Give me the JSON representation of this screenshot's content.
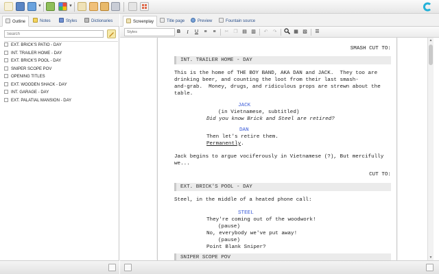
{
  "toolbar": {
    "icons": [
      "new-document-icon",
      "open-folder-icon",
      "save-disk-icon",
      "refresh-sync-icon",
      "google-drive-icon",
      "cut-icon",
      "upload-icon",
      "print-icon",
      "share-icon",
      "export-icon",
      "grid-icon"
    ],
    "logo": "celtx-logo"
  },
  "left_panel": {
    "tabs": [
      {
        "label": "Outline",
        "icon": "outline-icon",
        "active": true
      },
      {
        "label": "Notes",
        "icon": "notes-icon",
        "active": false
      },
      {
        "label": "Styles",
        "icon": "styles-icon",
        "active": false
      },
      {
        "label": "Dictionaries",
        "icon": "book-icon",
        "active": false
      }
    ],
    "search_placeholder": "Search",
    "outline_items": [
      "EXT. BRICK'S PATIO - DAY",
      "INT. TRAILER HOME - DAY",
      "EXT. BRICK'S POOL - DAY",
      "SNIPER SCOPE POV",
      "OPENING TITLES",
      "EXT. WOODEN SHACK - DAY",
      "INT. GARAGE - DAY",
      "EXT. PALATIAL MANSION - DAY"
    ]
  },
  "right_panel": {
    "tabs": [
      {
        "label": "Screenplay",
        "icon": "screenplay-icon",
        "active": true
      },
      {
        "label": "Title page",
        "icon": "title-page-icon",
        "active": false
      },
      {
        "label": "Preview",
        "icon": "preview-icon",
        "active": false
      },
      {
        "label": "Fountain source",
        "icon": "source-icon",
        "active": false
      }
    ],
    "format": {
      "styles_label": "Styles",
      "bold": "B",
      "italic": "I",
      "underline": "U"
    }
  },
  "script": {
    "transition_top": "SMASH CUT TO:",
    "scene1_heading": "INT. TRAILER HOME - DAY",
    "scene1_action": "This is the home of THE BOY BAND, AKA DAN and JACK.  They too are\ndrinking beer, and counting the loot from their last smash-\nand-grab.  Money, drugs, and ridiculous props are strewn about the\ntable.",
    "char_jack": "JACK",
    "paren_jack": "(in Vietnamese, subtitled)",
    "dialogue_jack": "Did you know Brick and Steel are retired?",
    "char_dan": "DAN",
    "dialogue_dan_1": "Then let's retire them.",
    "dialogue_dan_2": "Permanently",
    "dialogue_dan_2_end": ".",
    "action_2": "Jack begins to argue vociferously in Vietnamese (?), But mercifully\nwe...",
    "transition_2": "CUT TO:",
    "scene2_heading": "EXT. BRICK'S POOL - DAY",
    "scene2_action": "Steel, in the middle of a heated phone call:",
    "char_steel": "STEEL",
    "dialogue_steel_1": "They're coming out of the woodwork!",
    "paren_steel_1": "(pause)",
    "dialogue_steel_2": "No, everybody we've put away!",
    "paren_steel_2": "(pause)",
    "dialogue_steel_3": "Point Blank Sniper?",
    "scene3_heading": "SNIPER SCOPE POV"
  },
  "colors": {
    "character_name": "#3a5bd8",
    "tab_text": "#2a4f8a",
    "logo": "#23b1d8"
  }
}
